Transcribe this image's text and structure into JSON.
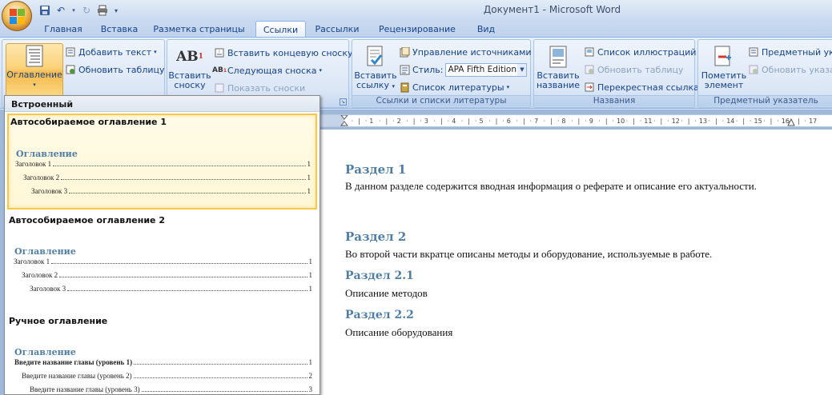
{
  "window": {
    "title": "Документ1 - Microsoft Word"
  },
  "tabs": [
    {
      "label": "Главная",
      "active": false
    },
    {
      "label": "Вставка",
      "active": false
    },
    {
      "label": "Разметка страницы",
      "active": false
    },
    {
      "label": "Ссылки",
      "active": true
    },
    {
      "label": "Рассылки",
      "active": false
    },
    {
      "label": "Рецензирование",
      "active": false
    },
    {
      "label": "Вид",
      "active": false
    }
  ],
  "ribbon": {
    "toc_group": {
      "toc_button": "Оглавление",
      "add_text": "Добавить текст",
      "update_table": "Обновить таблицу"
    },
    "footnotes_group": {
      "insert_footnote_line1": "Вставить",
      "insert_footnote_line2": "сноску",
      "insert_endnote": "Вставить концевую сноску",
      "next_footnote": "Следующая сноска",
      "show_notes": "Показать сноски"
    },
    "citations_group": {
      "label": "Ссылки и списки литературы",
      "insert_citation_line1": "Вставить",
      "insert_citation_line2": "ссылку",
      "manage_sources": "Управление источниками",
      "style_label": "Стиль:",
      "style_value": "APA Fifth Edition",
      "bibliography": "Список литературы"
    },
    "captions_group": {
      "label": "Названия",
      "insert_caption_line1": "Вставить",
      "insert_caption_line2": "название",
      "table_of_figures": "Список иллюстраций",
      "update_table": "Обновить таблицу",
      "cross_reference": "Перекрестная ссылка"
    },
    "index_group": {
      "label": "Предметный указатель",
      "mark_entry_line1": "Пометить",
      "mark_entry_line2": "элемент",
      "insert_index": "Предметный ука",
      "update_index": "Обновить указа"
    }
  },
  "gallery": {
    "header": "Встроенный",
    "sections": [
      {
        "title": "Автособираемое оглавление 1",
        "preview_title": "Оглавление",
        "lines": [
          {
            "text": "Заголовок 1",
            "page": "1",
            "bold": false
          },
          {
            "text": "Заголовок 2",
            "page": "1",
            "bold": false
          },
          {
            "text": "Заголовок 3",
            "page": "1",
            "bold": false
          }
        ]
      },
      {
        "title": "Автособираемое оглавление 2",
        "preview_title": "Оглавление",
        "lines": [
          {
            "text": "Заголовок 1",
            "page": "1",
            "bold": false
          },
          {
            "text": "Заголовок 2",
            "page": "1",
            "bold": false
          },
          {
            "text": "Заголовок 3",
            "page": "1",
            "bold": false
          }
        ]
      },
      {
        "title": "Ручное оглавление",
        "preview_title": "Оглавление",
        "lines": [
          {
            "text": "Введите название главы (уровень 1)",
            "page": "1",
            "bold": true
          },
          {
            "text": "Введите название главы (уровень 2)",
            "page": "2",
            "bold": false
          },
          {
            "text": "Введите название главы (уровень 3)",
            "page": "3",
            "bold": false
          }
        ]
      }
    ]
  },
  "ruler": {
    "ticks": [
      "1",
      "2",
      "3",
      "4",
      "5",
      "6",
      "7",
      "8",
      "9",
      "10",
      "11",
      "12",
      "13",
      "14",
      "15",
      "16",
      "17"
    ]
  },
  "document": {
    "blocks": [
      {
        "heading": "Раздел 1",
        "level": 1,
        "text": "В данном разделе содержится вводная информация о реферате и описание его актуальности."
      },
      {
        "heading": "Раздел 2",
        "level": 1,
        "text": "Во второй части вкратце описаны методы и оборудование, используемые в работе."
      },
      {
        "heading": "Раздел 2.1",
        "level": 2,
        "text": "Описание методов"
      },
      {
        "heading": "Раздел 2.2",
        "level": 2,
        "text": "Описание оборудования"
      }
    ]
  },
  "colors": {
    "heading": "#4f7da3",
    "accent_hover": "#f6c74a",
    "ribbon_text": "#15428b"
  }
}
